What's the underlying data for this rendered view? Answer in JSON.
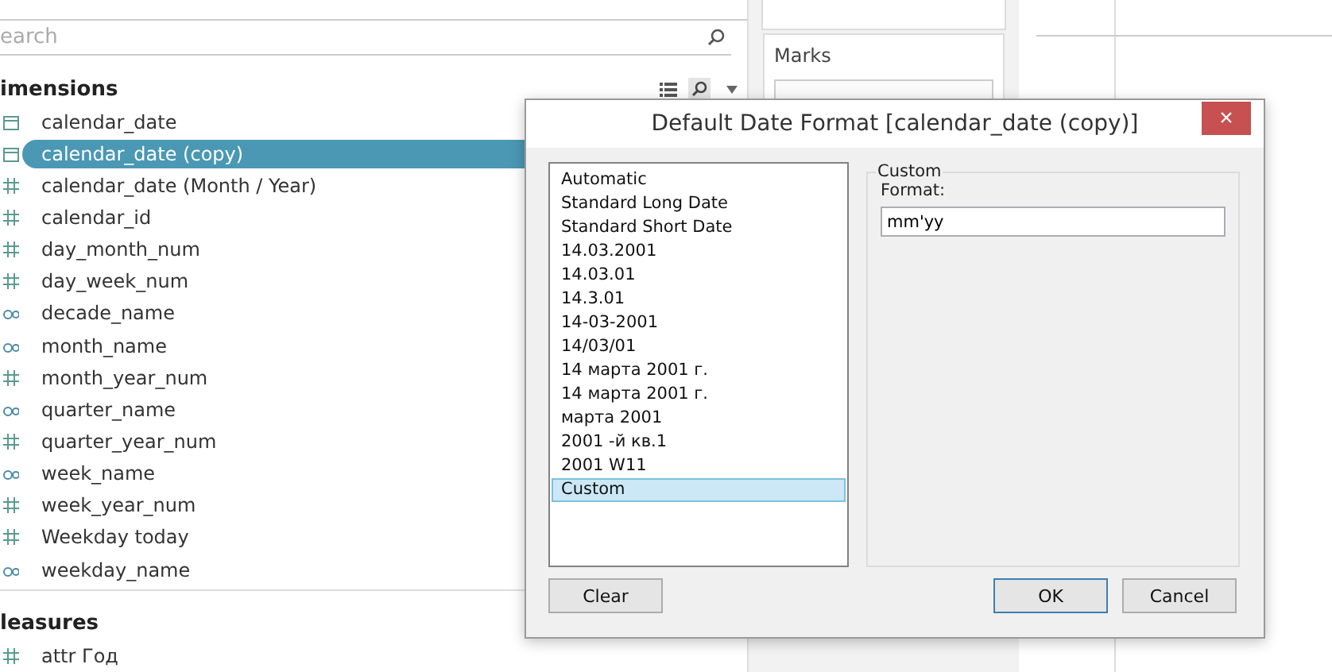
{
  "data_pane": {
    "search": {
      "placeholder": "earch"
    },
    "sections": [
      {
        "title": "imensions",
        "fields": [
          {
            "name": "calendar_date",
            "kind": "date",
            "selected": false
          },
          {
            "name": "calendar_date (copy)",
            "kind": "date",
            "selected": true
          },
          {
            "name": "calendar_date (Month / Year)",
            "kind": "number",
            "selected": false
          },
          {
            "name": "calendar_id",
            "kind": "number",
            "selected": false
          },
          {
            "name": "day_month_num",
            "kind": "number",
            "selected": false
          },
          {
            "name": "day_week_num",
            "kind": "number",
            "selected": false
          },
          {
            "name": "decade_name",
            "kind": "string",
            "selected": false
          },
          {
            "name": "month_name",
            "kind": "string",
            "selected": false
          },
          {
            "name": "month_year_num",
            "kind": "number",
            "selected": false
          },
          {
            "name": "quarter_name",
            "kind": "string",
            "selected": false
          },
          {
            "name": "quarter_year_num",
            "kind": "number",
            "selected": false
          },
          {
            "name": "week_name",
            "kind": "string",
            "selected": false
          },
          {
            "name": "week_year_num",
            "kind": "number",
            "selected": false
          },
          {
            "name": "Weekday today",
            "kind": "number",
            "selected": false
          },
          {
            "name": "weekday_name",
            "kind": "string",
            "selected": false
          }
        ]
      },
      {
        "title": "leasures",
        "fields": [
          {
            "name": "attr Год",
            "kind": "number",
            "selected": false
          }
        ]
      }
    ]
  },
  "marks_card": {
    "title": "Marks"
  },
  "dialog": {
    "title": "Default Date Format [calendar_date (copy)]",
    "close": "×",
    "formats": [
      {
        "label": "Automatic",
        "selected": false
      },
      {
        "label": "Standard Long Date",
        "selected": false
      },
      {
        "label": "Standard Short Date",
        "selected": false
      },
      {
        "label": "14.03.2001",
        "selected": false
      },
      {
        "label": "14.03.01",
        "selected": false
      },
      {
        "label": "14.3.01",
        "selected": false
      },
      {
        "label": "14-03-2001",
        "selected": false
      },
      {
        "label": "14/03/01",
        "selected": false
      },
      {
        "label": "14 марта 2001 г.",
        "selected": false
      },
      {
        "label": "14 марта 2001 г.",
        "selected": false
      },
      {
        "label": "марта 2001",
        "selected": false
      },
      {
        "label": "2001 -й кв.1",
        "selected": false
      },
      {
        "label": "2001 W11",
        "selected": false
      },
      {
        "label": "Custom",
        "selected": true
      }
    ],
    "custom": {
      "legend": "Custom",
      "label": "Format:",
      "value": "mm'yy"
    },
    "buttons": [
      {
        "label": "Clear",
        "default": false
      },
      {
        "label": "OK",
        "default": true
      },
      {
        "label": "Cancel",
        "default": false
      }
    ]
  }
}
